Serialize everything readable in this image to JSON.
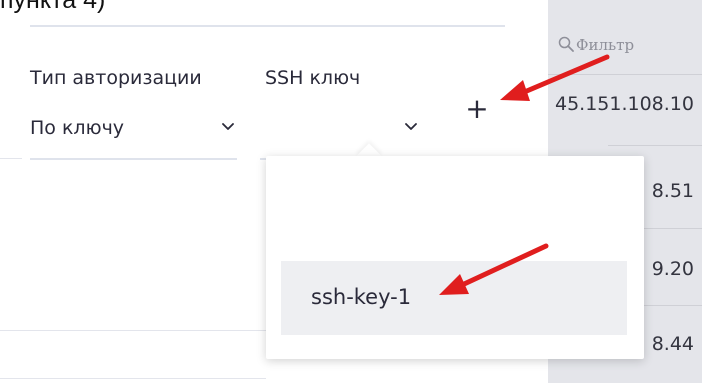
{
  "caption": {
    "text": "пункта 4)"
  },
  "form": {
    "auth_type_label": "Тип авторизации",
    "auth_type_value": "По ключу",
    "ssh_key_label": "SSH ключ",
    "ssh_key_value": "",
    "add_button_label": "+"
  },
  "dropdown": {
    "options": [
      {
        "label": "ssh-key-1"
      }
    ]
  },
  "table": {
    "filter_placeholder": "Фильтр",
    "ip_cells": [
      "45.151.108.10",
      "8.51",
      "9.20",
      "8.44"
    ]
  },
  "annotations": {
    "arrow_color": "#e01e1e"
  },
  "icons": {
    "filter": "search-icon",
    "chevron": "chevron-down-icon",
    "add": "plus-icon",
    "arrow": "red-arrow"
  }
}
